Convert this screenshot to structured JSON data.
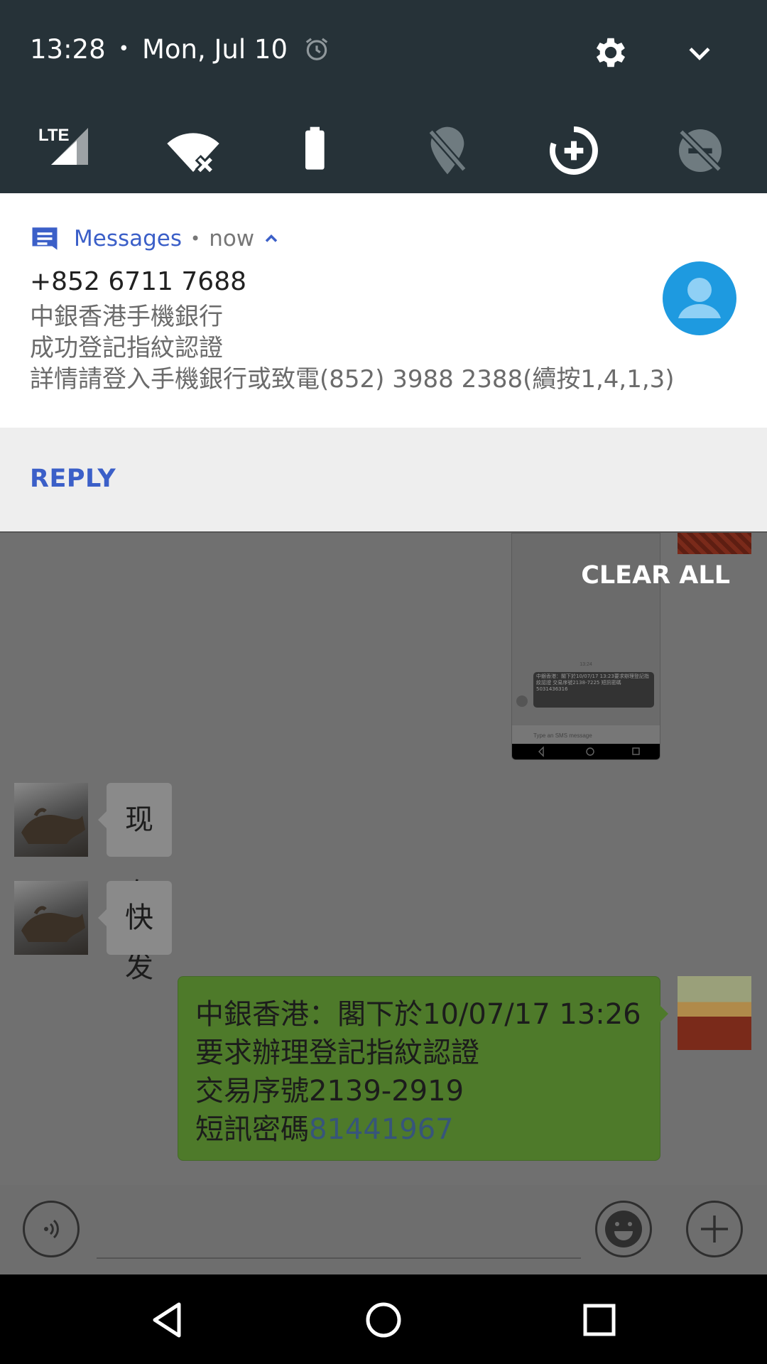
{
  "status": {
    "time": "13:28",
    "separator": "•",
    "date": "Mon, Jul 10",
    "icons": [
      "alarm-icon",
      "settings-icon",
      "chevron-down-icon"
    ]
  },
  "quick_settings": {
    "tiles": [
      {
        "name": "lte-signal-icon",
        "label": "LTE"
      },
      {
        "name": "wifi-off-icon"
      },
      {
        "name": "battery-icon"
      },
      {
        "name": "location-off-icon"
      },
      {
        "name": "data-saver-icon"
      },
      {
        "name": "do-not-disturb-off-icon"
      }
    ]
  },
  "notification": {
    "app_name": "Messages",
    "separator": "•",
    "time": "now",
    "sender": "+852 6711 7688",
    "lines": [
      "中銀香港手機銀行",
      "成功登記指紋認證",
      "詳情請登入手機銀行或致電(852) 3988 2388(續按1,4,1,3)"
    ],
    "reply_label": "REPLY",
    "accent": "#3b5fc8",
    "avatar_color": "#1e9ae0"
  },
  "chat": {
    "clear_all": "CLEAR ALL",
    "thumbnail": {
      "time": "13:24",
      "text": "中銀香港：閣下於10/07/17 13:23要求辦理登記指紋認證 交易序號2138-7225 短訊密碼5031436316",
      "placeholder": "Type an SMS message"
    },
    "messages": [
      {
        "from": "other",
        "text": "现在发"
      },
      {
        "from": "other",
        "text": "快"
      },
      {
        "from": "me",
        "lines": [
          "中銀香港：閣下於10/07/17 13:26",
          "要求辦理登記指紋認證",
          "交易序號2139-2919"
        ],
        "last_prefix": "短訊密碼",
        "code": "81441967"
      }
    ]
  },
  "input_bar": {
    "icons": [
      "voice-icon",
      "emoji-icon",
      "add-icon"
    ]
  },
  "nav": {
    "icons": [
      "back-icon",
      "home-icon",
      "recents-icon"
    ]
  }
}
